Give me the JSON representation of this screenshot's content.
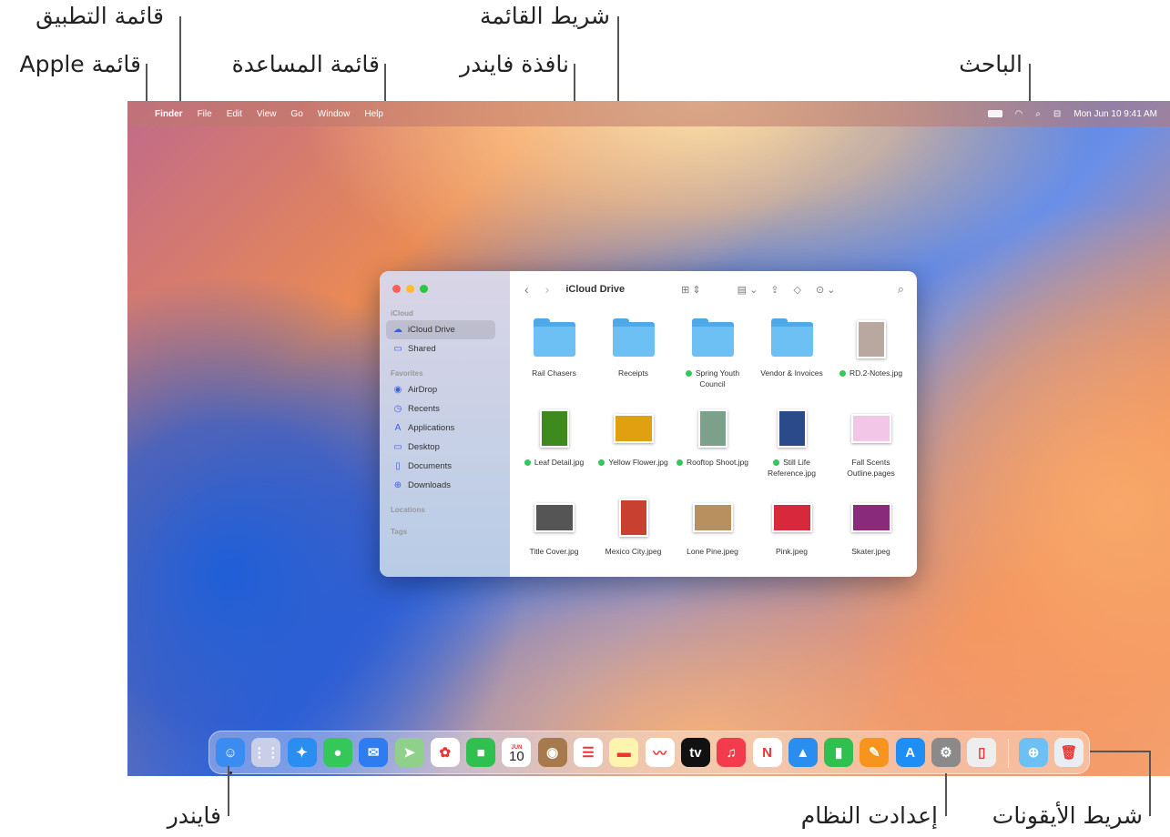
{
  "annotations": {
    "app_menu": "قائمة التطبيق",
    "apple_menu": "قائمة Apple",
    "help_menu": "قائمة المساعدة",
    "menu_bar": "شريط القائمة",
    "finder_window": "نافذة فايندر",
    "spotlight": "الباحث",
    "finder": "فايندر",
    "system_settings": "إعدادت النظام",
    "dock": "شريط الأيقونات"
  },
  "menubar": {
    "apple": "",
    "items": [
      "Finder",
      "File",
      "Edit",
      "View",
      "Go",
      "Window",
      "Help"
    ],
    "clock": "Mon Jun 10  9:41 AM"
  },
  "finder": {
    "title": "iCloud Drive",
    "sidebar": {
      "sections": [
        {
          "label": "iCloud",
          "items": [
            {
              "label": "iCloud Drive",
              "icon": "cloud-icon",
              "glyph": "☁"
            },
            {
              "label": "Shared",
              "icon": "shared-folder-icon",
              "glyph": "▭"
            }
          ]
        },
        {
          "label": "Favorites",
          "items": [
            {
              "label": "AirDrop",
              "icon": "airdrop-icon",
              "glyph": "◉"
            },
            {
              "label": "Recents",
              "icon": "clock-icon",
              "glyph": "◷"
            },
            {
              "label": "Applications",
              "icon": "applications-icon",
              "glyph": "A"
            },
            {
              "label": "Desktop",
              "icon": "desktop-icon",
              "glyph": "▭"
            },
            {
              "label": "Documents",
              "icon": "document-icon",
              "glyph": "▯"
            },
            {
              "label": "Downloads",
              "icon": "download-icon",
              "glyph": "⊕"
            }
          ]
        },
        {
          "label": "Locations",
          "items": []
        },
        {
          "label": "Tags",
          "items": []
        }
      ]
    },
    "files": [
      {
        "name": "Rail Chasers",
        "type": "folder",
        "tag": false
      },
      {
        "name": "Receipts",
        "type": "folder",
        "tag": false
      },
      {
        "name": "Spring Youth Council",
        "type": "folder",
        "tag": true
      },
      {
        "name": "Vendor & Invoices",
        "type": "folder",
        "tag": false
      },
      {
        "name": "RD.2-Notes.jpg",
        "type": "image",
        "tag": true,
        "color": "#b8a8a0",
        "shape": "tall"
      },
      {
        "name": "Leaf Detail.jpg",
        "type": "image",
        "tag": true,
        "color": "#3f8a1e",
        "shape": "tall"
      },
      {
        "name": "Yellow Flower.jpg",
        "type": "image",
        "tag": true,
        "color": "#e0a010",
        "shape": "wide"
      },
      {
        "name": "Rooftop Shoot.jpg",
        "type": "image",
        "tag": true,
        "color": "#7ca08a",
        "shape": "tall"
      },
      {
        "name": "Still Life Reference.jpg",
        "type": "image",
        "tag": true,
        "color": "#2a4a8a",
        "shape": "tall"
      },
      {
        "name": "Fall Scents Outline.pages",
        "type": "doc",
        "tag": false,
        "color": "#f2c6e6",
        "shape": "wide"
      },
      {
        "name": "Title Cover.jpg",
        "type": "image",
        "tag": false,
        "color": "#555",
        "shape": "wide"
      },
      {
        "name": "Mexico City.jpeg",
        "type": "image",
        "tag": false,
        "color": "#c84030",
        "shape": "tall"
      },
      {
        "name": "Lone Pine.jpeg",
        "type": "image",
        "tag": false,
        "color": "#b89060",
        "shape": "wide"
      },
      {
        "name": "Pink.jpeg",
        "type": "image",
        "tag": false,
        "color": "#d8283c",
        "shape": "wide"
      },
      {
        "name": "Skater.jpeg",
        "type": "image",
        "tag": false,
        "color": "#8a2a7a",
        "shape": "wide"
      }
    ]
  },
  "dock": [
    {
      "name": "finder",
      "bg": "#3a8cf0",
      "g": "☺",
      "running": true
    },
    {
      "name": "launchpad",
      "bg": "#c9cfe8",
      "g": "⋮⋮"
    },
    {
      "name": "safari",
      "bg": "#2a8ef0",
      "g": "✦"
    },
    {
      "name": "messages",
      "bg": "#34c759",
      "g": "●"
    },
    {
      "name": "mail",
      "bg": "#2f7cf0",
      "g": "✉"
    },
    {
      "name": "maps",
      "bg": "#8fd18a",
      "g": "➤"
    },
    {
      "name": "photos",
      "bg": "#ffffff",
      "g": "✿"
    },
    {
      "name": "facetime",
      "bg": "#30c04f",
      "g": "■"
    },
    {
      "name": "calendar",
      "bg": "#ffffff",
      "g": "10",
      "top": "JUN"
    },
    {
      "name": "contacts",
      "bg": "#a67a4c",
      "g": "◉"
    },
    {
      "name": "reminders",
      "bg": "#ffffff",
      "g": "☰"
    },
    {
      "name": "notes",
      "bg": "#fff3b0",
      "g": "▬"
    },
    {
      "name": "freeform",
      "bg": "#ffffff",
      "g": "〰"
    },
    {
      "name": "tv",
      "bg": "#111111",
      "g": "tv"
    },
    {
      "name": "music",
      "bg": "#f23c4e",
      "g": "♫"
    },
    {
      "name": "news",
      "bg": "#ffffff",
      "g": "N"
    },
    {
      "name": "keynote",
      "bg": "#2a8ef0",
      "g": "▲"
    },
    {
      "name": "numbers",
      "bg": "#30c04f",
      "g": "▮"
    },
    {
      "name": "pages",
      "bg": "#f7941d",
      "g": "✎"
    },
    {
      "name": "app-store",
      "bg": "#1e8ef5",
      "g": "A"
    },
    {
      "name": "system-settings",
      "bg": "#8a8a8a",
      "g": "⚙"
    },
    {
      "name": "iphone-mirroring",
      "bg": "#eeeeee",
      "g": "▯"
    },
    {
      "name": "downloads-folder",
      "bg": "#6cc0f3",
      "g": "⊕"
    },
    {
      "name": "trash",
      "bg": "#e8eef2",
      "g": "🗑"
    }
  ]
}
